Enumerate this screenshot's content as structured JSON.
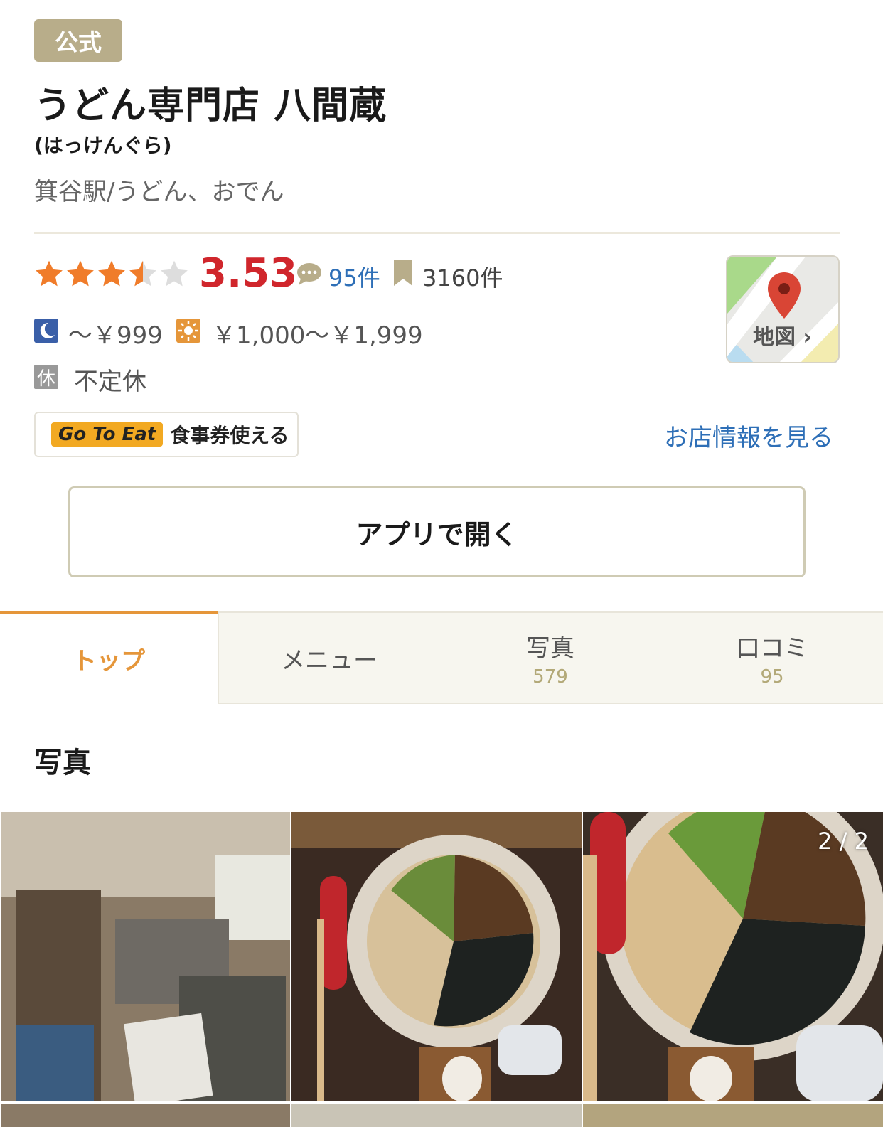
{
  "badge": {
    "official": "公式"
  },
  "shop": {
    "name": "うどん専門店 八間蔵",
    "yomi": "(はっけんぐら)",
    "area": "箕谷駅/うどん、おでん"
  },
  "rating": {
    "score": "3.53",
    "stars_value": 3.53,
    "stars_max": 5
  },
  "reviews": {
    "count": "95件",
    "icon": "speech-bubble-icon"
  },
  "bookmarks": {
    "count": "3160件",
    "icon": "bookmark-icon"
  },
  "price": {
    "dinner": "～￥999",
    "lunch": "￥1,000～￥1,999",
    "dinner_icon": "moon-icon",
    "lunch_icon": "sun-icon"
  },
  "holiday": {
    "label": "休",
    "text": "不定休"
  },
  "goto_eat": {
    "badge": "Go To Eat",
    "text": "食事券使える"
  },
  "links": {
    "store_info": "お店情報を見る",
    "map": "地図"
  },
  "buttons": {
    "open_app": "アプリで開く"
  },
  "tabs": [
    {
      "label": "トップ",
      "count": ""
    },
    {
      "label": "メニュー",
      "count": ""
    },
    {
      "label": "写真",
      "count": "579"
    },
    {
      "label": "口コミ",
      "count": "95"
    }
  ],
  "photos": {
    "section_title": "写真",
    "counter": "2 / 2"
  },
  "colors": {
    "accent": "#e5963a",
    "rating_red": "#d0262c",
    "link_blue": "#2e6fb7",
    "badge_beige": "#b8ad8a",
    "star_orange": "#f07c2a"
  }
}
